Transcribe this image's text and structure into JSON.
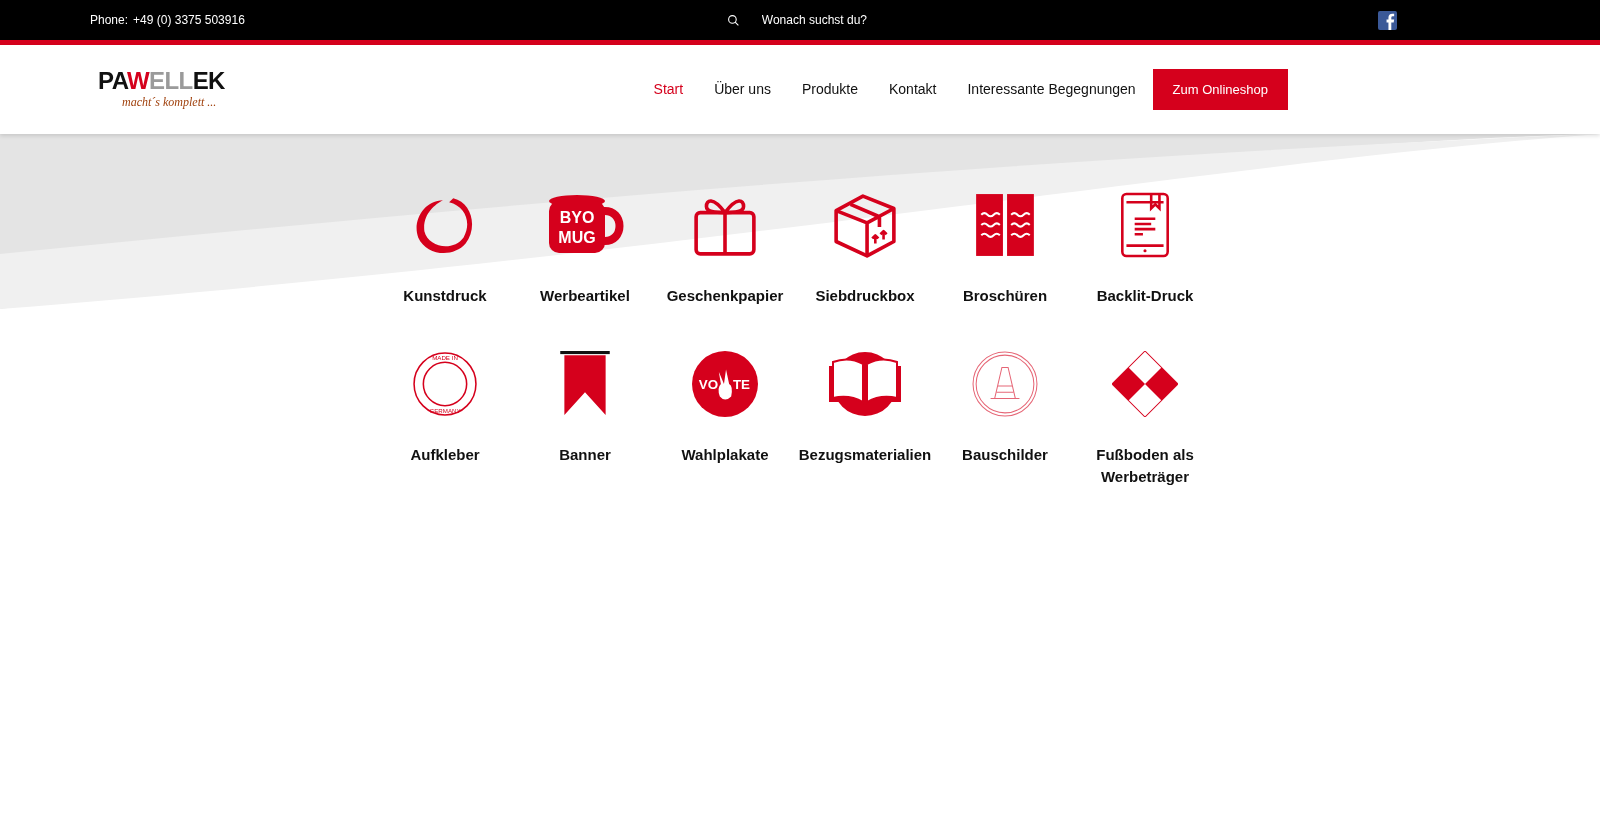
{
  "top_bar": {
    "phone_label": "Phone:",
    "phone": "+49 (0) 3375 503916",
    "search": {
      "placeholder": "Wonach suchst du?"
    }
  },
  "logo": {
    "parts": [
      {
        "text": "PA",
        "color": "#111111"
      },
      {
        "text": "W",
        "color": "#d5001c"
      },
      {
        "text": "ELL",
        "color": "#9a9a9a"
      },
      {
        "text": "EK",
        "color": "#111111"
      }
    ],
    "tagline": "macht´s komplett ..."
  },
  "nav": {
    "items": [
      {
        "label": "Start",
        "selected": true
      },
      {
        "label": "Über uns",
        "selected": false
      },
      {
        "label": "Produkte",
        "selected": false
      },
      {
        "label": "Kontakt",
        "selected": false
      },
      {
        "label": "Interessante Begegnungen",
        "selected": false
      }
    ],
    "cta": "Zum Onlineshop"
  },
  "products": [
    {
      "label": "Kunstdruck",
      "kind": "brush-circle"
    },
    {
      "label": "Werbeartikel",
      "kind": "mug",
      "icon_text": [
        "BYO",
        "MUG"
      ]
    },
    {
      "label": "Geschenkpapier",
      "kind": "gift"
    },
    {
      "label": "Siebdruckbox",
      "kind": "box"
    },
    {
      "label": "Broschüren",
      "kind": "brochure"
    },
    {
      "label": "Backlit-Druck",
      "kind": "tablet"
    },
    {
      "label": "Aufkleber",
      "kind": "seal",
      "icon_text": [
        "MADE IN",
        "GERMANY"
      ]
    },
    {
      "label": "Banner",
      "kind": "banner"
    },
    {
      "label": "Wahlplakate",
      "kind": "vote",
      "icon_text": [
        "VO",
        "TE"
      ]
    },
    {
      "label": "Bezugsmaterialien",
      "kind": "book"
    },
    {
      "label": "Bauschilder",
      "kind": "cone"
    },
    {
      "label": "Fußboden als Werbeträger",
      "kind": "diamonds"
    }
  ]
}
